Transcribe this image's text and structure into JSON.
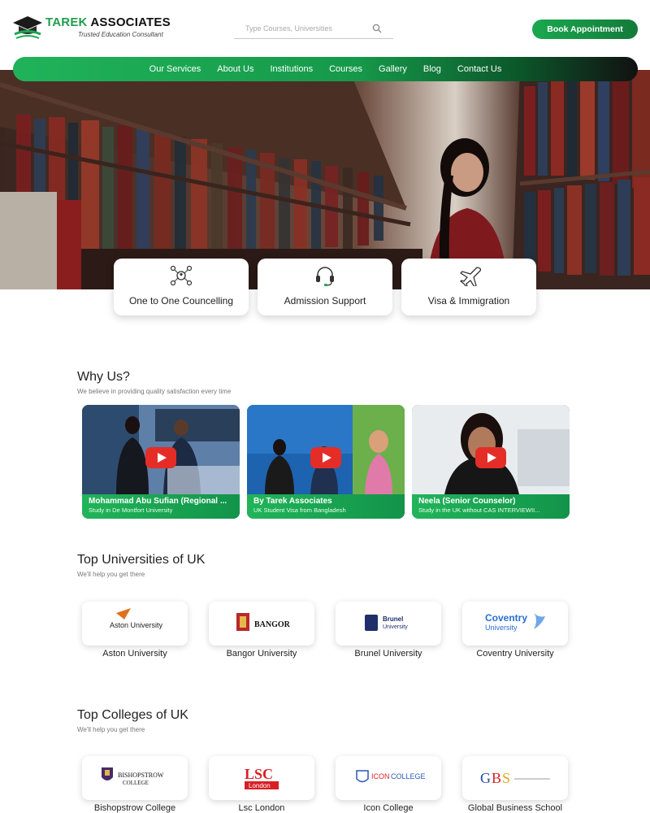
{
  "header": {
    "brand_name_part1": "TAREK",
    "brand_name_part2": "ASSOCIATES",
    "tagline": "Trusted Education Consultant",
    "search_placeholder": "Type Courses, Universities",
    "book_button": "Book Appointment"
  },
  "nav": {
    "items": [
      "Our Services",
      "About Us",
      "Institutions",
      "Courses",
      "Gallery",
      "Blog",
      "Contact Us"
    ]
  },
  "services": [
    {
      "label": "One to One Councelling",
      "icon": "network-people-icon"
    },
    {
      "label": "Admission Support",
      "icon": "headset-icon"
    },
    {
      "label": "Visa & Immigration",
      "icon": "airplane-icon"
    }
  ],
  "why_us": {
    "title": "Why Us?",
    "subtitle": "We believe in providing quality satisfaction every time",
    "videos": [
      {
        "title": "Mohammad Abu Sufian (Regional ...",
        "subtitle": "Study in De Montfort University"
      },
      {
        "title": "By Tarek Associates",
        "subtitle": "UK Student Visa from Bangladesh"
      },
      {
        "title": "Neela (Senior Counselor)",
        "subtitle": "Study in the UK without CAS INTERVIEWII..."
      }
    ]
  },
  "universities": {
    "title": "Top Universities of UK",
    "subtitle": "We'll help you get there",
    "items": [
      "Aston University",
      "Bangor University",
      "Brunel University",
      "Coventry University"
    ]
  },
  "colleges": {
    "title": "Top Colleges of UK",
    "subtitle": "We'll help you get there",
    "items": [
      "Bishopstrow College",
      "Lsc London",
      "Icon College",
      "Global Business School"
    ]
  },
  "colors": {
    "brand_green": "#1aa84f",
    "dark_green": "#0c5a2c",
    "youtube_red": "#e52d27"
  }
}
